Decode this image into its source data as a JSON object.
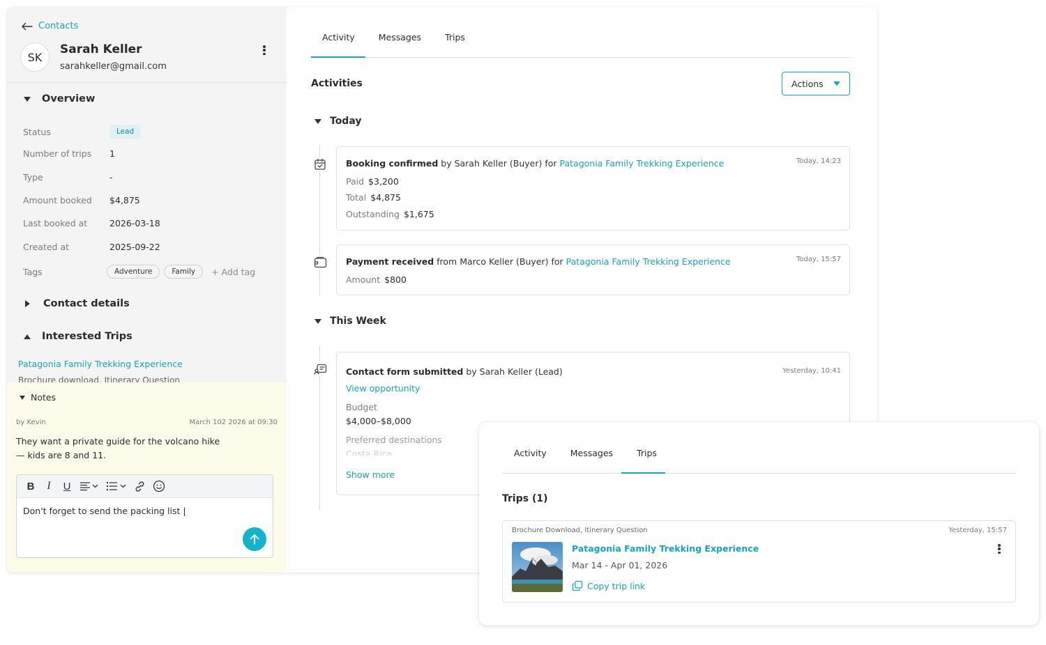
{
  "contact": {
    "back_label": "Contacts",
    "initials": "SK",
    "name": "Sarah Keller",
    "email": "sarahkeller@gmail.com"
  },
  "overview": {
    "title": "Overview",
    "rows": [
      {
        "label": "Status",
        "value": "Lead"
      },
      {
        "label": "Number of trips",
        "value": "1"
      },
      {
        "label": "Type",
        "value": "-"
      },
      {
        "label": "Amount booked",
        "value": "$4,875"
      },
      {
        "label": "Last booked at",
        "value": "2026-03-18"
      },
      {
        "label": "Created at",
        "value": "2025-09-22"
      },
      {
        "label": "Tags",
        "value": ""
      }
    ],
    "tags": [
      "Adventure",
      "Family"
    ],
    "add_tag_label": "+ Add tag"
  },
  "contact_details": {
    "title": "Contact details"
  },
  "interested_trips": {
    "title": "Interested Trips",
    "trip_name": "Patagonia Family Trekking Experience",
    "trip_sub": "Brochure download, Itinerary Question"
  },
  "notes": {
    "title": "Notes",
    "note": {
      "author": "by Kevin",
      "date": "March 102 2026 at 09:30",
      "text": "They want a private guide for the volcano hike — kids are 8 and 11."
    },
    "draft": "Don't forget to send the packing list |",
    "toolbar": {
      "bold": "B",
      "italic": "I",
      "underline": "U"
    }
  },
  "tabs": [
    "Activity",
    "Messages",
    "Trips"
  ],
  "activities": {
    "title": "Activities",
    "actions_label": "Actions",
    "groups": {
      "today": "Today",
      "this_week": "This Week"
    },
    "items": [
      {
        "title": "Booking confirmed",
        "middle": "by Sarah Keller (Buyer) for",
        "link": "Patagonia Family Trekking Experience",
        "time": "Today, 14:23",
        "details": [
          {
            "label": "Paid",
            "value": "$3,200"
          },
          {
            "label": "Total",
            "value": "$4,875"
          },
          {
            "label": "Outstanding",
            "value": "$1,675"
          }
        ]
      },
      {
        "title": "Payment received",
        "middle": "from Marco Keller (Buyer) for",
        "link": "Patagonia Family Trekking Experience",
        "time": "Today, 15:57",
        "details": [
          {
            "label": "Amount",
            "value": "$800"
          }
        ]
      },
      {
        "title": "Contact form submitted",
        "middle": "by Sarah Keller (Lead)",
        "time": "Yesterday, 10:41",
        "view_link": "View opportunity",
        "budget_label": "Budget",
        "budget_value": "$4,000–$8,000",
        "destinations_label": "Preferred destinations",
        "destinations_value": "Costa Rica",
        "show_more": "Show more"
      }
    ]
  },
  "trips_panel": {
    "tabs": [
      "Activity",
      "Messages",
      "Trips"
    ],
    "title": "Trips (1)",
    "trip": {
      "tags": "Brochure Download, Itinerary Question",
      "time": "Yesterday, 15:57",
      "name": "Patagonia Family Trekking Experience",
      "dates": "Mar 14 - Apr 01, 2026",
      "copy_label": "Copy trip link"
    }
  },
  "colors": {
    "accent": "#14a4bd",
    "notes_bg": "#fdfbe9",
    "panel_bg": "#f4f4f4"
  }
}
